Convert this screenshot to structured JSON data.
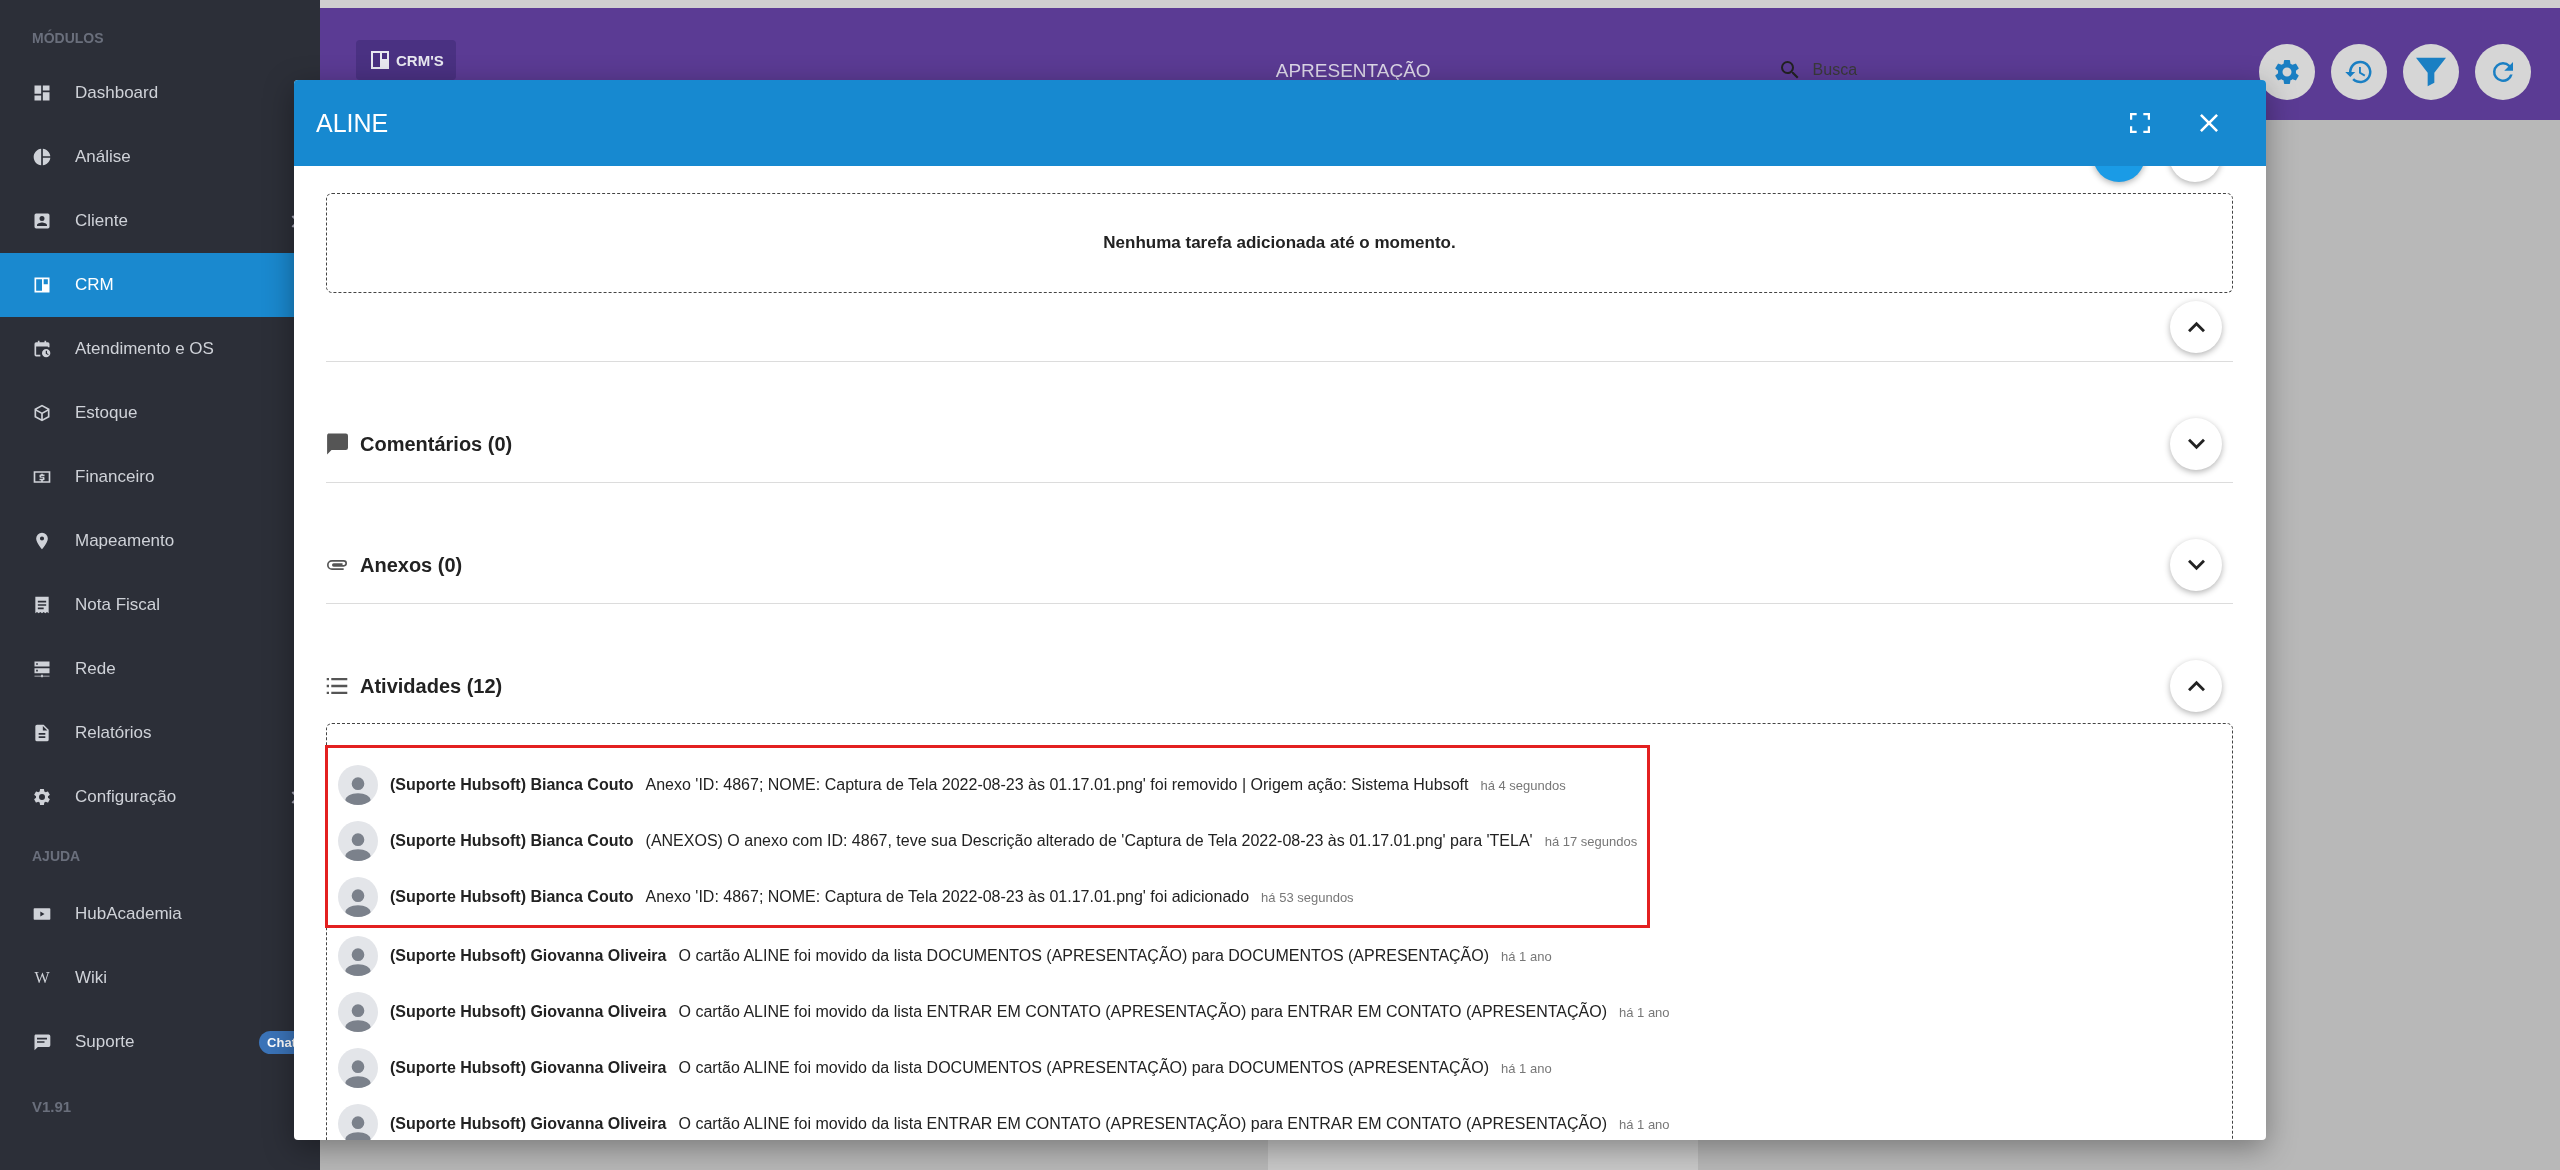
{
  "sidebar": {
    "sections": [
      {
        "heading": "MÓDULOS",
        "items": [
          {
            "label": "Dashboard",
            "selected": false,
            "expandable": false
          },
          {
            "label": "Análise",
            "selected": false,
            "expandable": false
          },
          {
            "label": "Cliente",
            "selected": false,
            "expandable": true
          },
          {
            "label": "CRM",
            "selected": true,
            "expandable": false
          },
          {
            "label": "Atendimento e OS",
            "selected": false,
            "expandable": false
          },
          {
            "label": "Estoque",
            "selected": false,
            "expandable": false
          },
          {
            "label": "Financeiro",
            "selected": false,
            "expandable": false
          },
          {
            "label": "Mapeamento",
            "selected": false,
            "expandable": false
          },
          {
            "label": "Nota Fiscal",
            "selected": false,
            "expandable": false
          },
          {
            "label": "Rede",
            "selected": false,
            "expandable": false
          },
          {
            "label": "Relatórios",
            "selected": false,
            "expandable": false
          },
          {
            "label": "Configuração",
            "selected": false,
            "expandable": true
          }
        ]
      },
      {
        "heading": "AJUDA",
        "items": [
          {
            "label": "HubAcademia",
            "selected": false,
            "expandable": false
          },
          {
            "label": "Wiki",
            "selected": false,
            "expandable": false,
            "icon_glyph": "W"
          },
          {
            "label": "Suporte",
            "selected": false,
            "expandable": false,
            "badge": "Chat"
          }
        ]
      }
    ],
    "version": "V1.91"
  },
  "header": {
    "board_button": "CRM'S",
    "title": "APRESENTAÇÃO",
    "search": {
      "placeholder": "Busca"
    }
  },
  "modal": {
    "title": "ALINE",
    "tasks": {
      "empty_message": "Nenhuma tarefa adicionada até o momento.",
      "expanded": true
    },
    "sections": [
      {
        "kind": "comments",
        "title": "Comentários (0)",
        "expanded": false
      },
      {
        "kind": "attachments",
        "title": "Anexos (0)",
        "expanded": false
      },
      {
        "kind": "activities",
        "title": "Atividades (12)",
        "expanded": true
      }
    ],
    "activities": [
      {
        "author": "(Suporte Hubsoft) Bianca Couto",
        "text": "Anexo 'ID: 4867; NOME: Captura de Tela 2022-08-23 às 01.17.01.png' foi removido | Origem ação: Sistema Hubsoft",
        "time": "há 4 segundos",
        "highlighted": true
      },
      {
        "author": "(Suporte Hubsoft) Bianca Couto",
        "text": "(ANEXOS) O anexo com ID: 4867, teve sua Descrição alterado de 'Captura de Tela 2022-08-23 às 01.17.01.png' para 'TELA'",
        "time": "há 17 segundos",
        "highlighted": true
      },
      {
        "author": "(Suporte Hubsoft) Bianca Couto",
        "text": "Anexo 'ID: 4867; NOME: Captura de Tela 2022-08-23 às 01.17.01.png' foi adicionado",
        "time": "há 53 segundos",
        "highlighted": true
      },
      {
        "author": "(Suporte Hubsoft) Giovanna Oliveira",
        "text": "O cartão ALINE foi movido da lista DOCUMENTOS (APRESENTAÇÃO) para DOCUMENTOS (APRESENTAÇÃO)",
        "time": "há 1 ano",
        "highlighted": false
      },
      {
        "author": "(Suporte Hubsoft) Giovanna Oliveira",
        "text": "O cartão ALINE foi movido da lista ENTRAR EM CONTATO (APRESENTAÇÃO) para ENTRAR EM CONTATO (APRESENTAÇÃO)",
        "time": "há 1 ano",
        "highlighted": false
      },
      {
        "author": "(Suporte Hubsoft) Giovanna Oliveira",
        "text": "O cartão ALINE foi movido da lista DOCUMENTOS (APRESENTAÇÃO) para DOCUMENTOS (APRESENTAÇÃO)",
        "time": "há 1 ano",
        "highlighted": false
      },
      {
        "author": "(Suporte Hubsoft) Giovanna Oliveira",
        "text": "O cartão ALINE foi movido da lista ENTRAR EM CONTATO (APRESENTAÇÃO) para ENTRAR EM CONTATO (APRESENTAÇÃO)",
        "time": "há 1 ano",
        "highlighted": false
      }
    ]
  }
}
